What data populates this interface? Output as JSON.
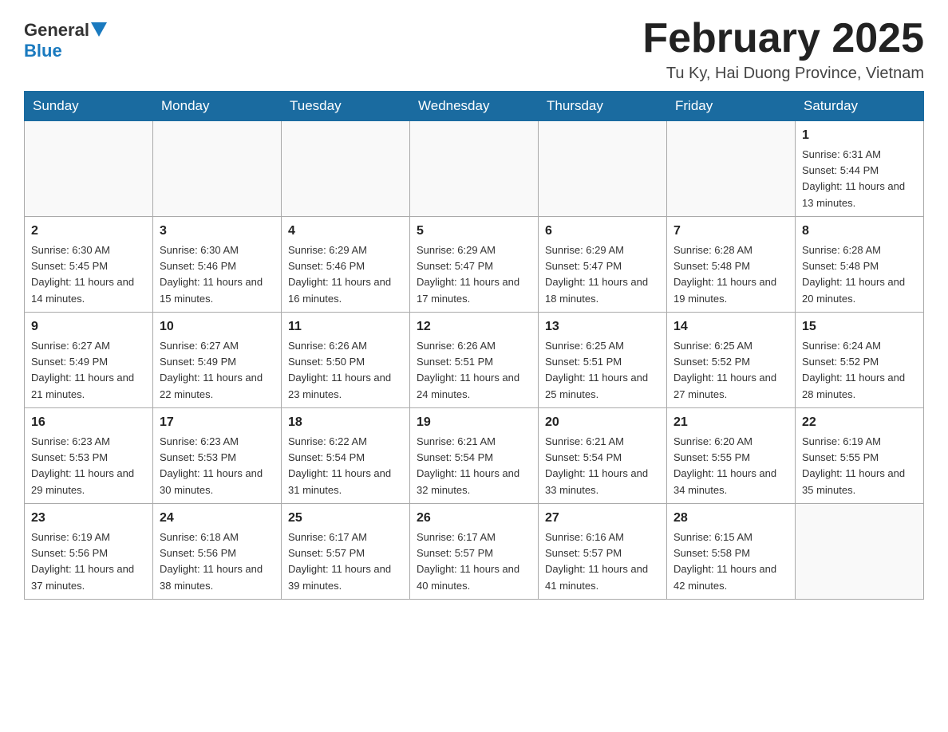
{
  "logo": {
    "general": "General",
    "blue": "Blue"
  },
  "header": {
    "title": "February 2025",
    "location": "Tu Ky, Hai Duong Province, Vietnam"
  },
  "weekdays": [
    "Sunday",
    "Monday",
    "Tuesday",
    "Wednesday",
    "Thursday",
    "Friday",
    "Saturday"
  ],
  "weeks": [
    [
      {
        "day": "",
        "info": ""
      },
      {
        "day": "",
        "info": ""
      },
      {
        "day": "",
        "info": ""
      },
      {
        "day": "",
        "info": ""
      },
      {
        "day": "",
        "info": ""
      },
      {
        "day": "",
        "info": ""
      },
      {
        "day": "1",
        "info": "Sunrise: 6:31 AM\nSunset: 5:44 PM\nDaylight: 11 hours and 13 minutes."
      }
    ],
    [
      {
        "day": "2",
        "info": "Sunrise: 6:30 AM\nSunset: 5:45 PM\nDaylight: 11 hours and 14 minutes."
      },
      {
        "day": "3",
        "info": "Sunrise: 6:30 AM\nSunset: 5:46 PM\nDaylight: 11 hours and 15 minutes."
      },
      {
        "day": "4",
        "info": "Sunrise: 6:29 AM\nSunset: 5:46 PM\nDaylight: 11 hours and 16 minutes."
      },
      {
        "day": "5",
        "info": "Sunrise: 6:29 AM\nSunset: 5:47 PM\nDaylight: 11 hours and 17 minutes."
      },
      {
        "day": "6",
        "info": "Sunrise: 6:29 AM\nSunset: 5:47 PM\nDaylight: 11 hours and 18 minutes."
      },
      {
        "day": "7",
        "info": "Sunrise: 6:28 AM\nSunset: 5:48 PM\nDaylight: 11 hours and 19 minutes."
      },
      {
        "day": "8",
        "info": "Sunrise: 6:28 AM\nSunset: 5:48 PM\nDaylight: 11 hours and 20 minutes."
      }
    ],
    [
      {
        "day": "9",
        "info": "Sunrise: 6:27 AM\nSunset: 5:49 PM\nDaylight: 11 hours and 21 minutes."
      },
      {
        "day": "10",
        "info": "Sunrise: 6:27 AM\nSunset: 5:49 PM\nDaylight: 11 hours and 22 minutes."
      },
      {
        "day": "11",
        "info": "Sunrise: 6:26 AM\nSunset: 5:50 PM\nDaylight: 11 hours and 23 minutes."
      },
      {
        "day": "12",
        "info": "Sunrise: 6:26 AM\nSunset: 5:51 PM\nDaylight: 11 hours and 24 minutes."
      },
      {
        "day": "13",
        "info": "Sunrise: 6:25 AM\nSunset: 5:51 PM\nDaylight: 11 hours and 25 minutes."
      },
      {
        "day": "14",
        "info": "Sunrise: 6:25 AM\nSunset: 5:52 PM\nDaylight: 11 hours and 27 minutes."
      },
      {
        "day": "15",
        "info": "Sunrise: 6:24 AM\nSunset: 5:52 PM\nDaylight: 11 hours and 28 minutes."
      }
    ],
    [
      {
        "day": "16",
        "info": "Sunrise: 6:23 AM\nSunset: 5:53 PM\nDaylight: 11 hours and 29 minutes."
      },
      {
        "day": "17",
        "info": "Sunrise: 6:23 AM\nSunset: 5:53 PM\nDaylight: 11 hours and 30 minutes."
      },
      {
        "day": "18",
        "info": "Sunrise: 6:22 AM\nSunset: 5:54 PM\nDaylight: 11 hours and 31 minutes."
      },
      {
        "day": "19",
        "info": "Sunrise: 6:21 AM\nSunset: 5:54 PM\nDaylight: 11 hours and 32 minutes."
      },
      {
        "day": "20",
        "info": "Sunrise: 6:21 AM\nSunset: 5:54 PM\nDaylight: 11 hours and 33 minutes."
      },
      {
        "day": "21",
        "info": "Sunrise: 6:20 AM\nSunset: 5:55 PM\nDaylight: 11 hours and 34 minutes."
      },
      {
        "day": "22",
        "info": "Sunrise: 6:19 AM\nSunset: 5:55 PM\nDaylight: 11 hours and 35 minutes."
      }
    ],
    [
      {
        "day": "23",
        "info": "Sunrise: 6:19 AM\nSunset: 5:56 PM\nDaylight: 11 hours and 37 minutes."
      },
      {
        "day": "24",
        "info": "Sunrise: 6:18 AM\nSunset: 5:56 PM\nDaylight: 11 hours and 38 minutes."
      },
      {
        "day": "25",
        "info": "Sunrise: 6:17 AM\nSunset: 5:57 PM\nDaylight: 11 hours and 39 minutes."
      },
      {
        "day": "26",
        "info": "Sunrise: 6:17 AM\nSunset: 5:57 PM\nDaylight: 11 hours and 40 minutes."
      },
      {
        "day": "27",
        "info": "Sunrise: 6:16 AM\nSunset: 5:57 PM\nDaylight: 11 hours and 41 minutes."
      },
      {
        "day": "28",
        "info": "Sunrise: 6:15 AM\nSunset: 5:58 PM\nDaylight: 11 hours and 42 minutes."
      },
      {
        "day": "",
        "info": ""
      }
    ]
  ]
}
